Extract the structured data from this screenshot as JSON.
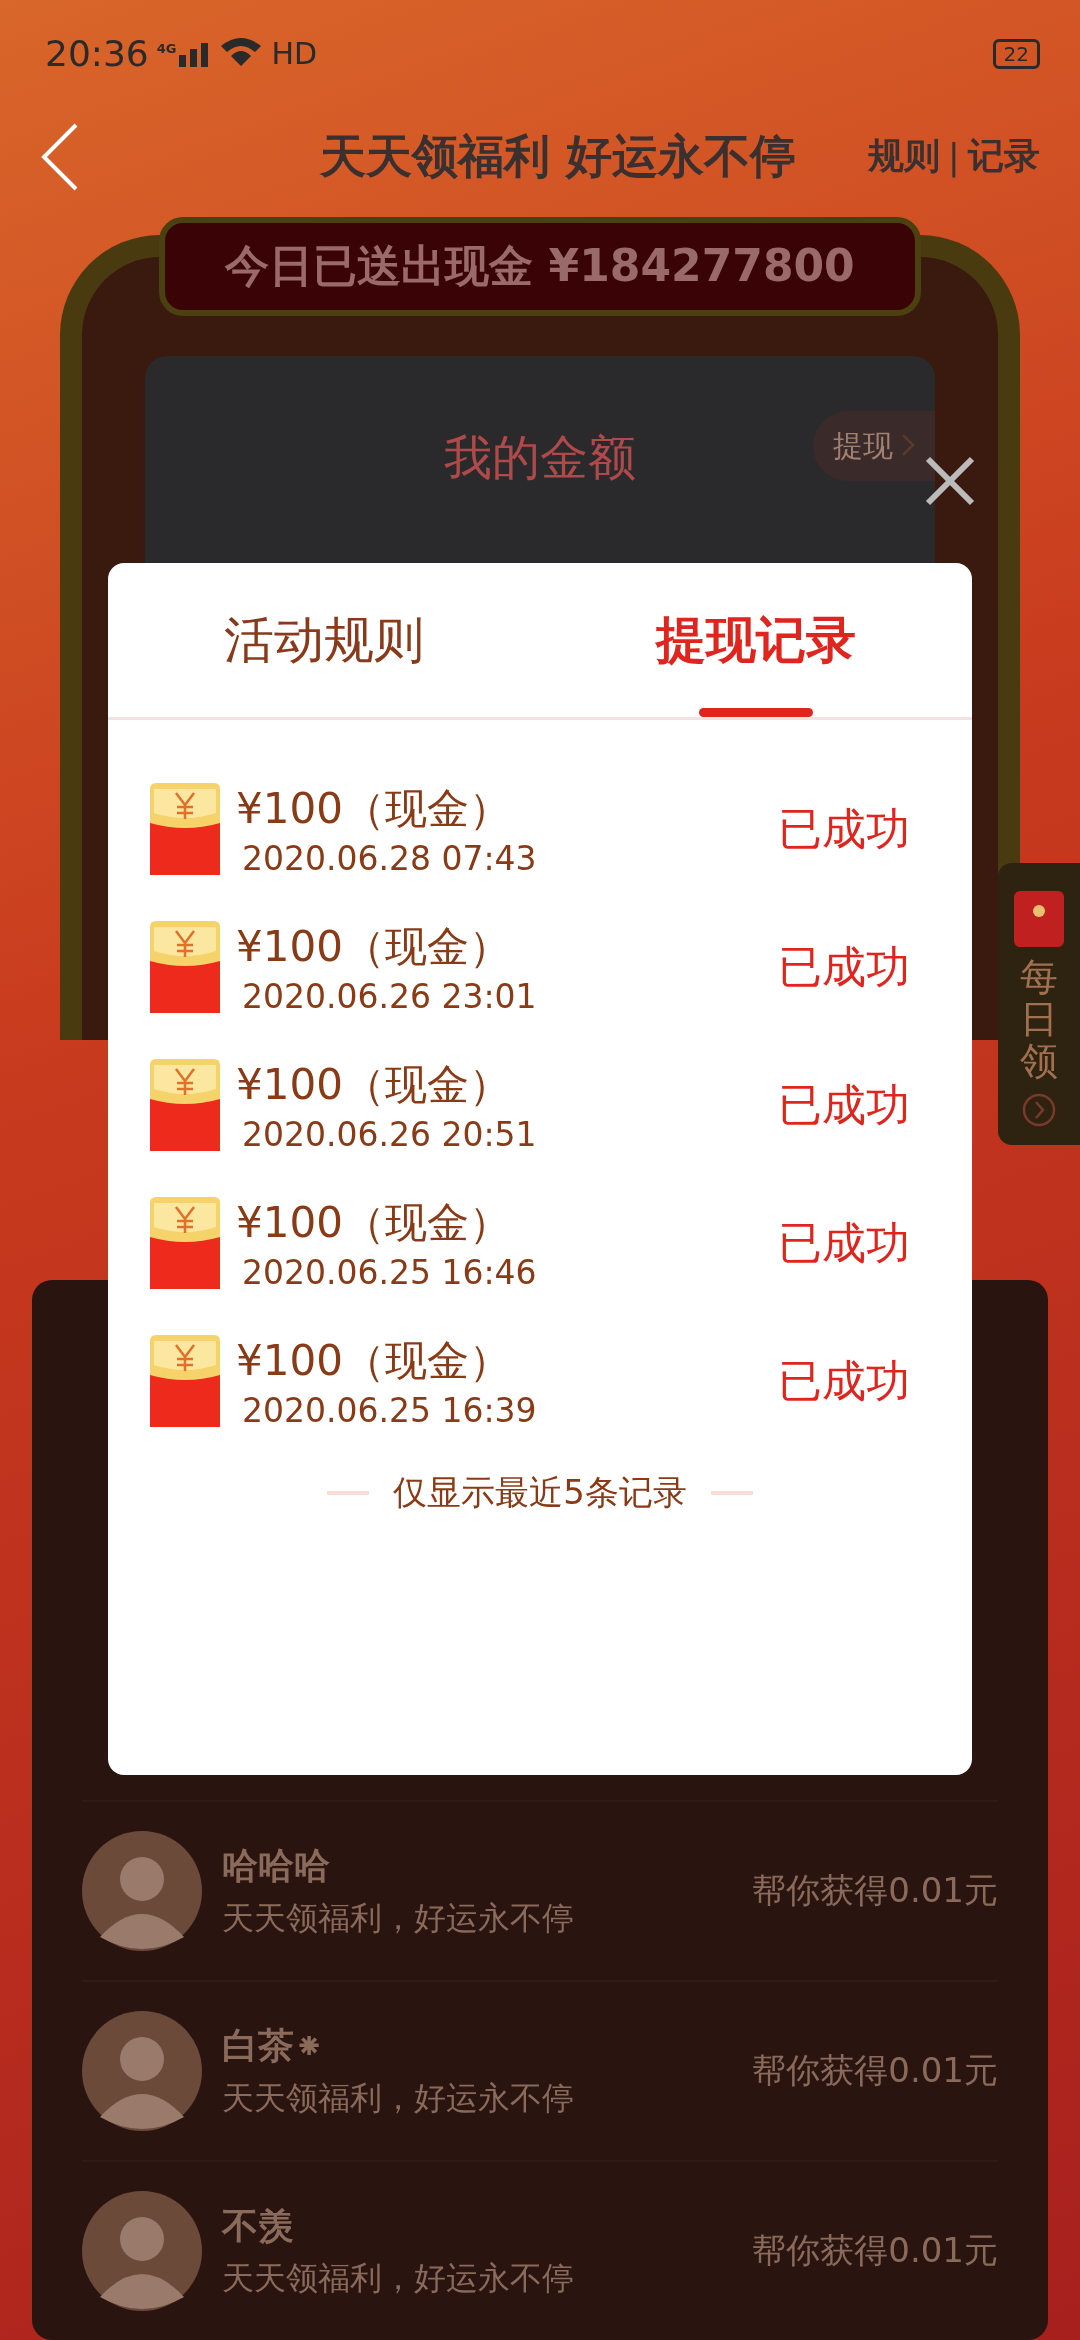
{
  "status_bar": {
    "time": "20:36",
    "network": "4G",
    "wifi_label": "HD",
    "battery": "22"
  },
  "header": {
    "title": "天天领福利 好运永不停",
    "links": [
      "规则",
      "记录"
    ],
    "separator": "|"
  },
  "banner": {
    "text": "今日已送出现金 ¥184277800"
  },
  "balance_card": {
    "title": "我的金额",
    "withdraw_label": "提现"
  },
  "side_widget": {
    "label": "每日领"
  },
  "helpers": [
    {
      "name": "哈哈哈",
      "subtitle": "天天领福利，好运永不停",
      "reward": "帮你获得0.01元"
    },
    {
      "name": "白茶⁕",
      "subtitle": "天天领福利，好运永不停",
      "reward": "帮你获得0.01元"
    },
    {
      "name": "不羡",
      "subtitle": "天天领福利，好运永不停",
      "reward": "帮你获得0.01元"
    }
  ],
  "modal": {
    "tabs": [
      {
        "label": "活动规则",
        "selected": false
      },
      {
        "label": "提现记录",
        "selected": true
      }
    ],
    "records": [
      {
        "amount": "¥100（现金）",
        "date": "2020.06.28 07:43",
        "status": "已成功"
      },
      {
        "amount": "¥100（现金）",
        "date": "2020.06.26 23:01",
        "status": "已成功"
      },
      {
        "amount": "¥100（现金）",
        "date": "2020.06.26 20:51",
        "status": "已成功"
      },
      {
        "amount": "¥100（现金）",
        "date": "2020.06.25 16:46",
        "status": "已成功"
      },
      {
        "amount": "¥100（现金）",
        "date": "2020.06.25 16:39",
        "status": "已成功"
      }
    ],
    "footer_note": "仅显示最近5条记录"
  }
}
